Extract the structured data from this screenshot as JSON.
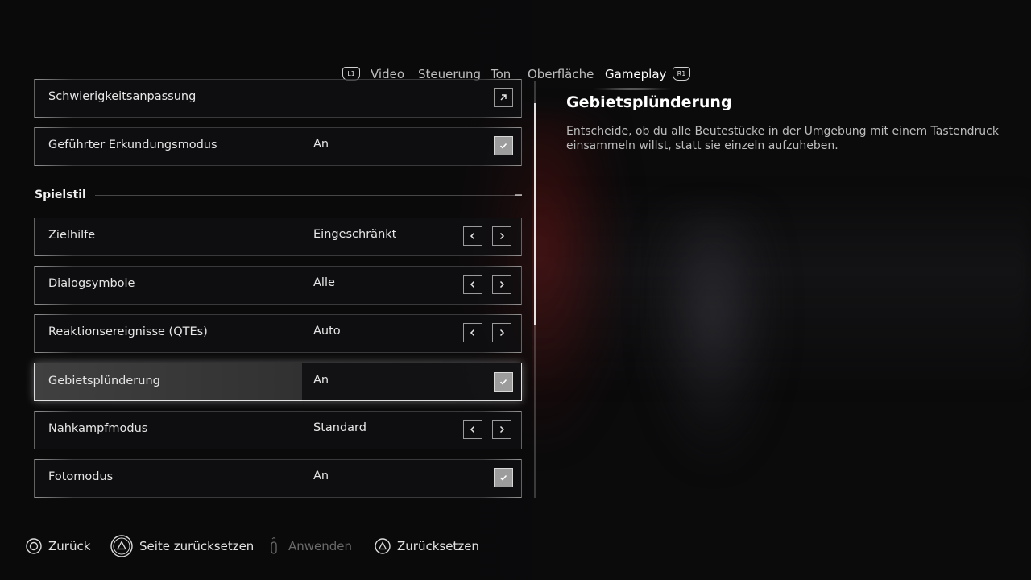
{
  "tabs": {
    "left_button": "L1",
    "right_button": "R1",
    "items": [
      "Video",
      "Steuerung",
      "Ton",
      "Oberfläche",
      "Gameplay"
    ],
    "active": "Gameplay"
  },
  "settings": {
    "rows_top": [
      {
        "label": "Schwierigkeitsanpassung",
        "value": "",
        "control": "external-link"
      },
      {
        "label": "Geführter Erkundungsmodus",
        "value": "An",
        "control": "checkbox",
        "checked": true
      }
    ],
    "section_title": "Spielstil",
    "rows": [
      {
        "label": "Zielhilfe",
        "value": "Eingeschränkt",
        "control": "arrows"
      },
      {
        "label": "Dialogsymbole",
        "value": "Alle",
        "control": "arrows"
      },
      {
        "label": "Reaktionsereignisse (QTEs)",
        "value": "Auto",
        "control": "arrows"
      },
      {
        "label": "Gebietsplünderung",
        "value": "An",
        "control": "checkbox",
        "checked": true,
        "selected": true
      },
      {
        "label": "Nahkampfmodus",
        "value": "Standard",
        "control": "arrows"
      },
      {
        "label": "Fotomodus",
        "value": "An",
        "control": "checkbox",
        "checked": true
      }
    ]
  },
  "description": {
    "title": "Gebietsplünderung",
    "body": "Entscheide, ob du alle Beutestücke in der Umgebung mit einem Tastendruck einsammeln willst, statt sie einzeln aufzuheben."
  },
  "footer": {
    "back": "Zurück",
    "reset_page": "Seite zurücksetzen",
    "apply": "Anwenden",
    "reset": "Zurücksetzen"
  },
  "colors": {
    "background": "#0b0b0c",
    "checkbox_fill": "#9c9c9c",
    "disabled_text": "#6a6a6a"
  }
}
